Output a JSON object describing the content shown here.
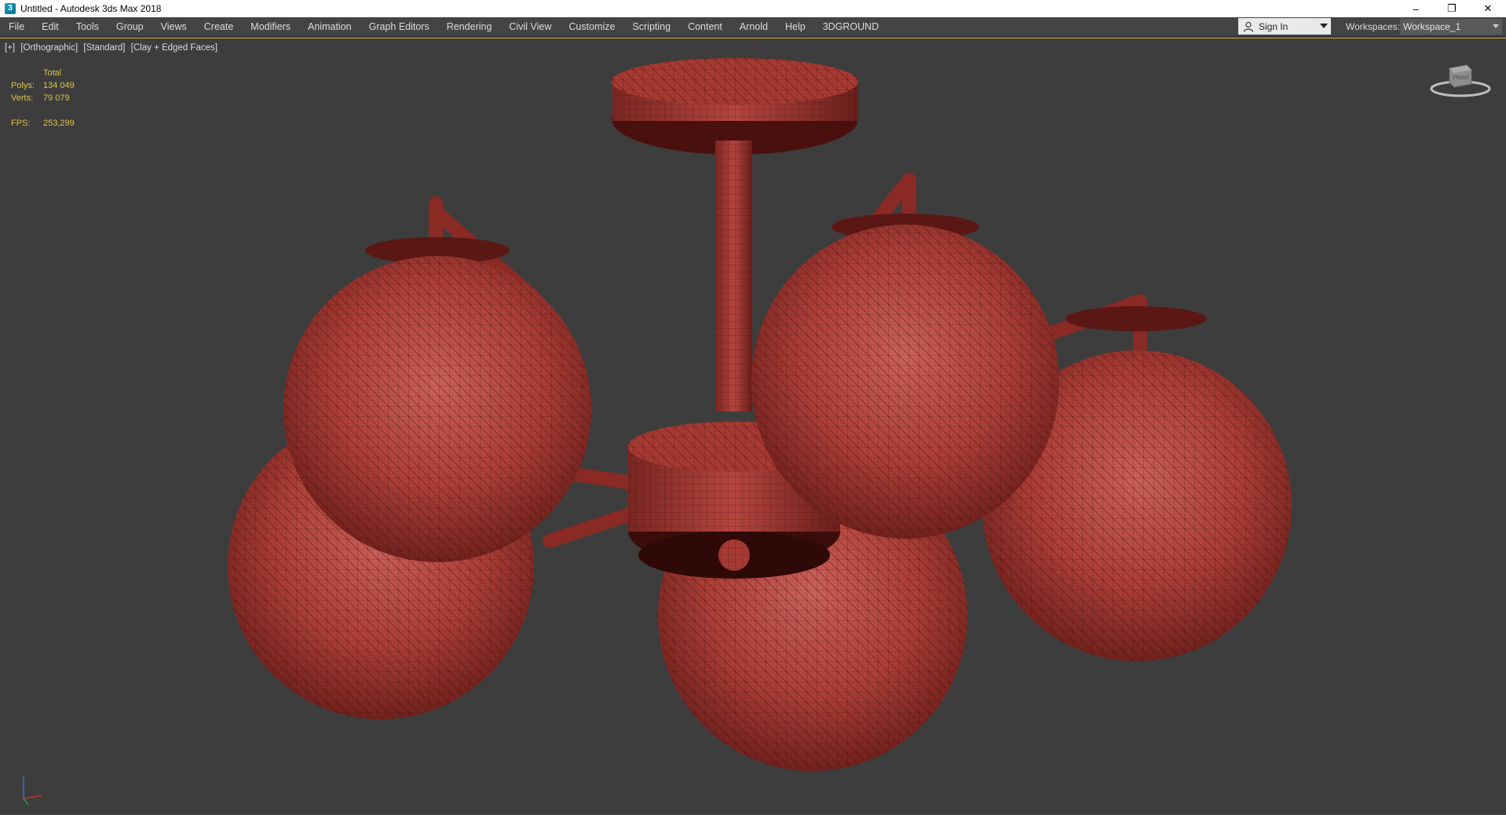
{
  "window": {
    "title": "Untitled - Autodesk 3ds Max 2018",
    "app_icon_glyph": "3",
    "controls": {
      "minimize": "–",
      "restore": "❐",
      "close": "✕"
    }
  },
  "menu": {
    "items": [
      "File",
      "Edit",
      "Tools",
      "Group",
      "Views",
      "Create",
      "Modifiers",
      "Animation",
      "Graph Editors",
      "Rendering",
      "Civil View",
      "Customize",
      "Scripting",
      "Content",
      "Arnold",
      "Help",
      "3DGROUND"
    ]
  },
  "account": {
    "sign_in_label": "Sign In"
  },
  "workspace": {
    "label": "Workspaces:",
    "value": "Workspace_1"
  },
  "viewport": {
    "label_parts": [
      "[+]",
      "[Orthographic]",
      "[Standard]",
      "[Clay + Edged Faces]"
    ],
    "stats": {
      "header": "Total",
      "polys_label": "Polys:",
      "polys_value": "134 049",
      "verts_label": "Verts:",
      "verts_value": "79 079",
      "fps_label": "FPS:",
      "fps_value": "253,299"
    },
    "model_color": "#b3403a",
    "background_color": "#3d3d3d"
  },
  "viewcube": {
    "face_label": "FRONT"
  }
}
